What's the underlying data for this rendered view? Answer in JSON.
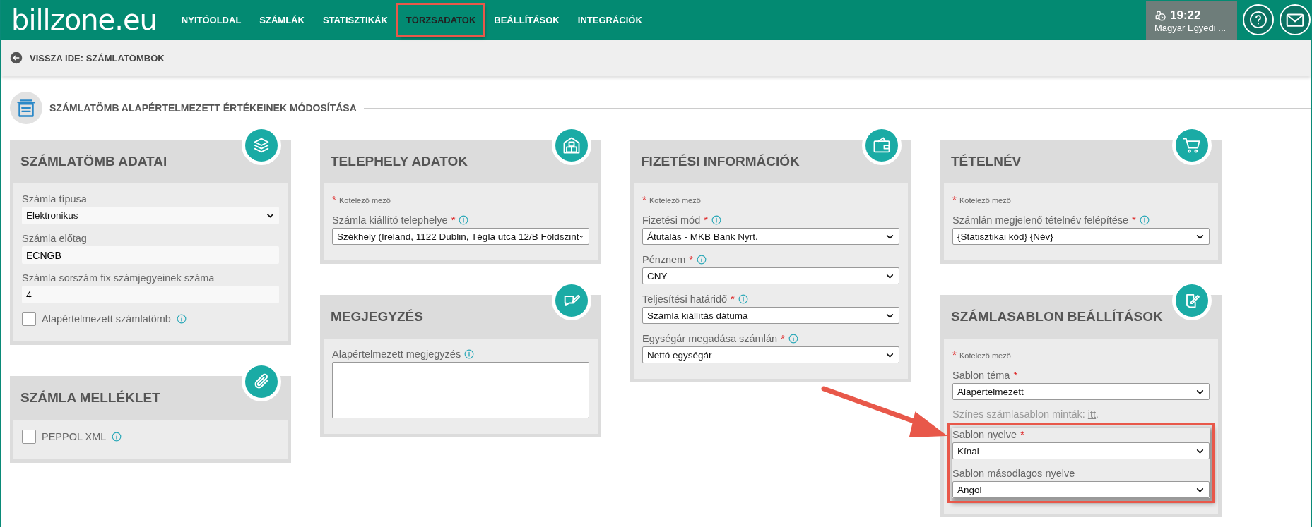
{
  "header": {
    "logo": "billzone.eu",
    "nav": [
      {
        "label": "NYITÓOLDAL",
        "selected": false,
        "highlighted": false
      },
      {
        "label": "SZÁMLÁK",
        "selected": false,
        "highlighted": false
      },
      {
        "label": "STATISZTIKÁK",
        "selected": false,
        "highlighted": false
      },
      {
        "label": "TÖRZSADATOK",
        "selected": true,
        "highlighted": true
      },
      {
        "label": "BEÁLLÍTÁSOK",
        "selected": false,
        "highlighted": false
      },
      {
        "label": "INTEGRÁCIÓK",
        "selected": false,
        "highlighted": false
      }
    ],
    "time": "19:22",
    "user": "Magyar Egyedi ..."
  },
  "back_link": "VISSZA IDE: SZÁMLATÖMBÖK",
  "page_title": "SZÁMLATÖMB ALAPÉRTELMEZETT ÉRTÉKEINEK MÓDOSÍTÁSA",
  "required_mark": "*",
  "columns": [
    {
      "cards": [
        {
          "title": "SZÁMLATÖMB ADATAI",
          "fields": [
            {
              "kind": "plain-select",
              "label": "Számla típusa",
              "value": "Elektronikus"
            },
            {
              "kind": "plain-input",
              "label": "Számla előtag",
              "value": "ECNGB"
            },
            {
              "kind": "plain-input",
              "label": "Számla sorszám fix számjegyeinek száma",
              "value": "4"
            },
            {
              "kind": "checkbox",
              "label": "Alapértelmezett számlatömb",
              "info": true,
              "checked": false
            }
          ]
        },
        {
          "title": "SZÁMLA MELLÉKLET",
          "fields": [
            {
              "kind": "checkbox",
              "label": "PEPPOL XML",
              "info": true,
              "checked": false
            }
          ]
        }
      ]
    },
    {
      "cards": [
        {
          "title": "TELEPHELY ADATOK",
          "required_note": "Kötelező mező",
          "fields": [
            {
              "kind": "select",
              "label": "Számla kiállító telephelye",
              "required": true,
              "info": true,
              "value": "Székhely (Ireland, 1122 Dublin, Tégla utca 12/B Földszint"
            }
          ]
        },
        {
          "title": "MEGJEGYZÉS",
          "fields": [
            {
              "kind": "textarea",
              "label": "Alapértelmezett megjegyzés",
              "info": true
            }
          ]
        }
      ]
    },
    {
      "cards": [
        {
          "title": "FIZETÉSI INFORMÁCIÓK",
          "required_note": "Kötelező mező",
          "fields": [
            {
              "kind": "select",
              "label": "Fizetési mód",
              "required": true,
              "info": true,
              "value": "Átutalás - MKB Bank Nyrt."
            },
            {
              "kind": "select",
              "label": "Pénznem",
              "required": true,
              "info": true,
              "value": "CNY"
            },
            {
              "kind": "select",
              "label": "Teljesítési határidő",
              "required": true,
              "info": true,
              "value": "Számla kiállítás dátuma"
            },
            {
              "kind": "select",
              "label": "Egységár megadása számlán",
              "required": true,
              "info": true,
              "value": "Nettó egységár"
            }
          ]
        }
      ]
    },
    {
      "cards": [
        {
          "title": "TÉTELNÉV",
          "required_note": "Kötelező mező",
          "fields": [
            {
              "kind": "select",
              "label": "Számlán megjelenő tételnév felépítése",
              "required": true,
              "info": true,
              "value": "{Statisztikai kód} {Név}"
            }
          ]
        },
        {
          "title": "SZÁMLASABLON BEÁLLÍTÁSOK",
          "required_note": "Kötelező mező",
          "fields": [
            {
              "kind": "select",
              "label": "Sablon téma",
              "required": true,
              "value": "Alapértelmezett"
            },
            {
              "kind": "note",
              "text": "Színes számlasablon minták:",
              "link": "itt",
              "after": "."
            },
            {
              "kind": "select",
              "label": "Sablon nyelve",
              "required": true,
              "value": "Kínai",
              "highlighted": true
            },
            {
              "kind": "select",
              "label": "Sablon másodlagos nyelve",
              "value": "Angol",
              "highlighted": true
            }
          ]
        }
      ]
    }
  ]
}
